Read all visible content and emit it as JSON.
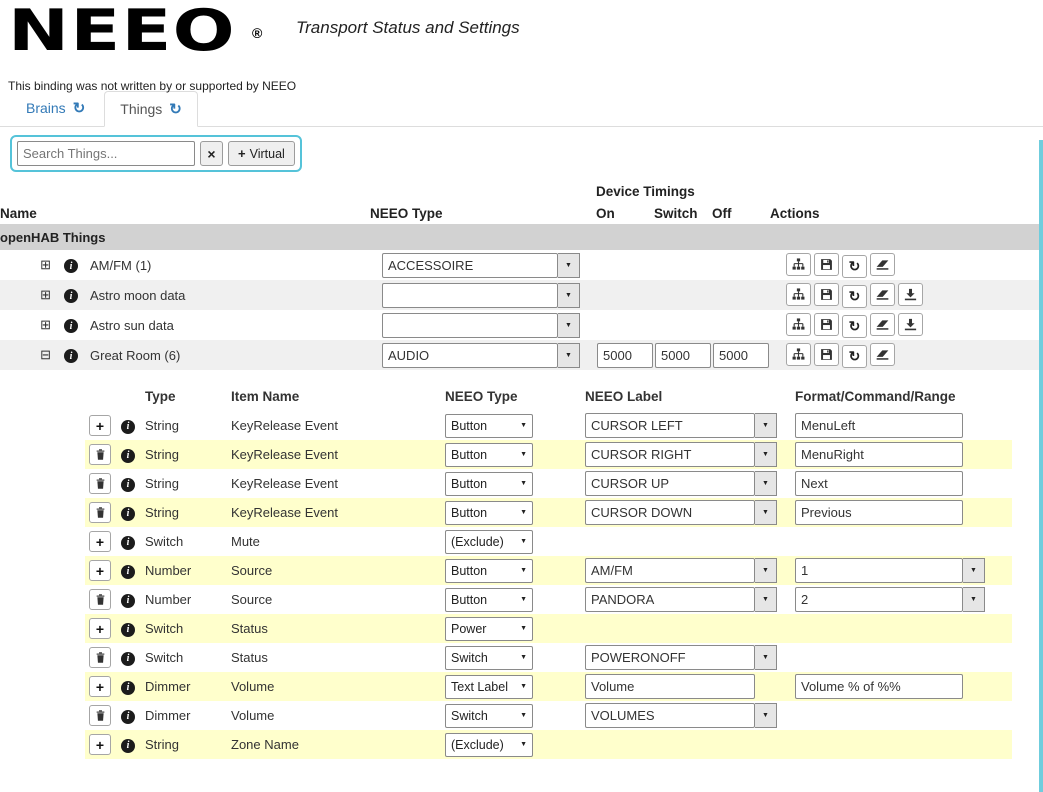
{
  "header": {
    "logo": "NEEO",
    "registered": "®",
    "subtitle": "Transport Status and Settings",
    "disclaimer": "This binding was not written by or supported by NEEO"
  },
  "tabs": [
    {
      "label": "Brains",
      "active": false
    },
    {
      "label": "Things",
      "active": true
    }
  ],
  "search": {
    "placeholder": "Search Things...",
    "virtual_label": "Virtual"
  },
  "things_table": {
    "section_label": "openHAB Things",
    "headers": {
      "name": "Name",
      "neeo_type": "NEEO Type",
      "device_timings": "Device Timings",
      "on": "On",
      "switch": "Switch",
      "off": "Off",
      "actions": "Actions"
    },
    "rows": [
      {
        "expanded": false,
        "name": "AM/FM (1)",
        "neeo_type": "ACCESSOIRE",
        "timings": null,
        "actions": [
          "sitemap",
          "save",
          "refresh",
          "eraser"
        ]
      },
      {
        "expanded": false,
        "name": "Astro moon data",
        "neeo_type": "",
        "timings": null,
        "actions": [
          "sitemap",
          "save",
          "refresh",
          "eraser",
          "download"
        ]
      },
      {
        "expanded": false,
        "name": "Astro sun data",
        "neeo_type": "",
        "timings": null,
        "actions": [
          "sitemap",
          "save",
          "refresh",
          "eraser",
          "download"
        ]
      },
      {
        "expanded": true,
        "name": "Great Room (6)",
        "neeo_type": "AUDIO",
        "timings": {
          "on": "5000",
          "switch": "5000",
          "off": "5000"
        },
        "actions": [
          "sitemap",
          "save",
          "refresh",
          "eraser"
        ]
      }
    ]
  },
  "channels_table": {
    "headers": [
      "Type",
      "Item Name",
      "NEEO Type",
      "NEEO Label",
      "Format/Command/Range"
    ],
    "rows": [
      {
        "action": "add",
        "type": "String",
        "item": "KeyRelease Event",
        "neeo_type": "Button",
        "label": "CURSOR LEFT",
        "label_dropdown": true,
        "format": "MenuLeft",
        "format_dropdown": false
      },
      {
        "action": "delete",
        "type": "String",
        "item": "KeyRelease Event",
        "neeo_type": "Button",
        "label": "CURSOR RIGHT",
        "label_dropdown": true,
        "format": "MenuRight",
        "format_dropdown": false
      },
      {
        "action": "delete",
        "type": "String",
        "item": "KeyRelease Event",
        "neeo_type": "Button",
        "label": "CURSOR UP",
        "label_dropdown": true,
        "format": "Next",
        "format_dropdown": false
      },
      {
        "action": "delete",
        "type": "String",
        "item": "KeyRelease Event",
        "neeo_type": "Button",
        "label": "CURSOR DOWN",
        "label_dropdown": true,
        "format": "Previous",
        "format_dropdown": false
      },
      {
        "action": "add",
        "type": "Switch",
        "item": "Mute",
        "neeo_type": "(Exclude)",
        "label": null,
        "label_dropdown": false,
        "format": null,
        "format_dropdown": false
      },
      {
        "action": "add",
        "type": "Number",
        "item": "Source",
        "neeo_type": "Button",
        "label": "AM/FM",
        "label_dropdown": true,
        "format": "1",
        "format_dropdown": true
      },
      {
        "action": "delete",
        "type": "Number",
        "item": "Source",
        "neeo_type": "Button",
        "label": "PANDORA",
        "label_dropdown": true,
        "format": "2",
        "format_dropdown": true
      },
      {
        "action": "add",
        "type": "Switch",
        "item": "Status",
        "neeo_type": "Power",
        "label": null,
        "label_dropdown": false,
        "format": null,
        "format_dropdown": false
      },
      {
        "action": "delete",
        "type": "Switch",
        "item": "Status",
        "neeo_type": "Switch",
        "label": "POWERONOFF",
        "label_dropdown": true,
        "format": null,
        "format_dropdown": false
      },
      {
        "action": "add",
        "type": "Dimmer",
        "item": "Volume",
        "neeo_type": "Text Label",
        "label": "Volume",
        "label_dropdown": false,
        "format": "Volume % of %%",
        "format_dropdown": false
      },
      {
        "action": "delete",
        "type": "Dimmer",
        "item": "Volume",
        "neeo_type": "Switch",
        "label": "VOLUMES",
        "label_dropdown": true,
        "format": null,
        "format_dropdown": false
      },
      {
        "action": "add",
        "type": "String",
        "item": "Zone Name",
        "neeo_type": "(Exclude)",
        "label": null,
        "label_dropdown": false,
        "format": null,
        "format_dropdown": false
      }
    ]
  }
}
